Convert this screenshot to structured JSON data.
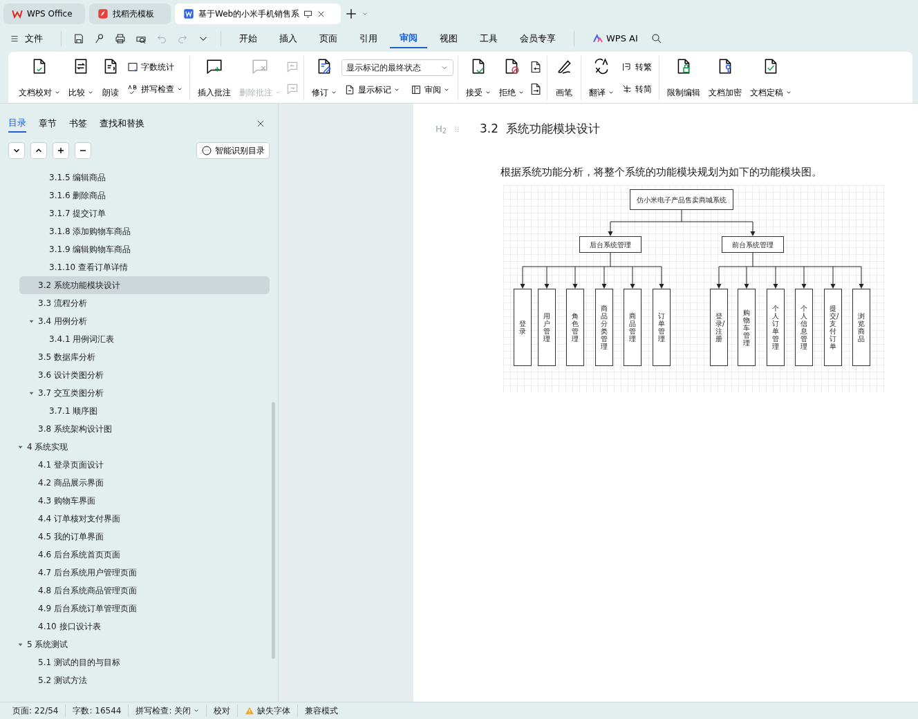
{
  "title_tabs": [
    {
      "label": "WPS Office",
      "selected": false
    },
    {
      "label": "找稻壳模板",
      "selected": false
    },
    {
      "label": "基于Web的小米手机销售系",
      "selected": true
    }
  ],
  "menu": {
    "file": "文件",
    "tabs": [
      {
        "label": "开始",
        "selected": false
      },
      {
        "label": "插入",
        "selected": false
      },
      {
        "label": "页面",
        "selected": false
      },
      {
        "label": "引用",
        "selected": false
      },
      {
        "label": "审阅",
        "selected": true
      },
      {
        "label": "视图",
        "selected": false
      },
      {
        "label": "工具",
        "selected": false
      },
      {
        "label": "会员专享",
        "selected": false
      }
    ],
    "ai": "WPS AI"
  },
  "ribbon": [
    [
      {
        "kind": "big",
        "label": "文档校对",
        "dropdown": true,
        "disabled": false
      },
      {
        "kind": "big",
        "label": "比较",
        "dropdown": true,
        "disabled": false
      },
      {
        "kind": "big",
        "label": "朗读",
        "dropdown": false,
        "disabled": false
      },
      {
        "kind": "stack",
        "items": [
          {
            "label": "字数统计",
            "dropdown": false
          },
          {
            "label": "拼写检查",
            "dropdown": true
          }
        ]
      }
    ],
    [
      {
        "kind": "big",
        "label": "插入批注",
        "dropdown": false,
        "disabled": false
      },
      {
        "kind": "big",
        "label": "删除批注",
        "dropdown": true,
        "disabled": true
      },
      {
        "kind": "icon_pair",
        "disabled": true
      }
    ],
    [
      {
        "kind": "big",
        "label": "修订",
        "dropdown": true,
        "disabled": false
      },
      {
        "kind": "select_stack",
        "value": "显示标记的最终状态",
        "items": [
          {
            "label": "显示标记",
            "dropdown": true
          },
          {
            "label": "审阅",
            "dropdown": true
          }
        ]
      }
    ],
    [
      {
        "kind": "big",
        "label": "接受",
        "dropdown": true,
        "disabled": false
      },
      {
        "kind": "big",
        "label": "拒绝",
        "dropdown": true,
        "disabled": false
      },
      {
        "kind": "icon_pair",
        "disabled": false
      }
    ],
    [
      {
        "kind": "big",
        "label": "画笔",
        "dropdown": false,
        "disabled": false
      }
    ],
    [
      {
        "kind": "big",
        "label": "翻译",
        "dropdown": true,
        "disabled": false
      },
      {
        "kind": "stack",
        "items": [
          {
            "label": "转繁",
            "dropdown": false
          },
          {
            "label": "转简",
            "dropdown": false
          }
        ]
      }
    ],
    [
      {
        "kind": "big",
        "label": "限制编辑",
        "dropdown": false,
        "disabled": false
      },
      {
        "kind": "big",
        "label": "文档加密",
        "dropdown": false,
        "disabled": false
      },
      {
        "kind": "big",
        "label": "文档定稿",
        "dropdown": true,
        "disabled": false
      }
    ]
  ],
  "sidebar": {
    "tabs": [
      {
        "label": "目录",
        "selected": true
      },
      {
        "label": "章节",
        "selected": false
      },
      {
        "label": "书签",
        "selected": false
      },
      {
        "label": "查找和替换",
        "selected": false
      }
    ],
    "smart_button": "智能识别目录",
    "toc": [
      {
        "children": [
          {
            "children": [
              {
                "label": "3.1.5 编辑商品",
                "selected": false
              },
              {
                "label": "3.1.6 删除商品",
                "selected": false
              },
              {
                "label": "3.1.7 提交订单",
                "selected": false
              },
              {
                "label": "3.1.8 添加购物车商品",
                "selected": false
              },
              {
                "label": "3.1.9 编辑购物车商品",
                "selected": false
              },
              {
                "label": "3.1.10 查看订单详情",
                "selected": false
              }
            ]
          },
          {
            "label": "3.2  系统功能模块设计",
            "selected": true
          },
          {
            "label": "3.3  流程分析",
            "selected": false
          },
          {
            "label": "3.4  用例分析",
            "selected": false,
            "expanded": true,
            "children": [
              {
                "label": "3.4.1 用例词汇表",
                "selected": false
              }
            ]
          },
          {
            "label": "3.5  数据库分析",
            "selected": false
          },
          {
            "label": "3.6 设计类图分析",
            "selected": false
          },
          {
            "label": "3.7  交互类图分析",
            "selected": false,
            "expanded": true,
            "children": [
              {
                "label": "3.7.1 顺序图",
                "selected": false
              }
            ]
          },
          {
            "label": "3.8  系统架构设计图",
            "selected": false
          }
        ]
      },
      {
        "label": "4  系统实现",
        "selected": false,
        "expanded": true,
        "children": [
          {
            "label": "4.1 登录页面设计",
            "selected": false
          },
          {
            "label": "4.2 商品展示界面",
            "selected": false
          },
          {
            "label": "4.3  购物车界面",
            "selected": false
          },
          {
            "label": "4.4 订单核对支付界面",
            "selected": false
          },
          {
            "label": "4.5 我的订单界面",
            "selected": false
          },
          {
            "label": "4.6 后台系统首页页面",
            "selected": false
          },
          {
            "label": "4.7 后台系统用户管理页面",
            "selected": false
          },
          {
            "label": "4.8 后台系统商品管理页面",
            "selected": false
          },
          {
            "label": "4.9 后台系统订单管理页面",
            "selected": false
          },
          {
            "label": "4.10 接口设计表",
            "selected": false
          }
        ]
      },
      {
        "label": "5  系统测试",
        "selected": false,
        "expanded": true,
        "children": [
          {
            "label": "5.1  测试的目的与目标",
            "selected": false
          },
          {
            "label": "5.2  测试方法",
            "selected": false
          }
        ]
      }
    ]
  },
  "document": {
    "heading_marker": "H$_{2}$",
    "heading_number": "3.2",
    "heading": "系统功能模块设计",
    "paragraph": "根据系统功能分析，将整个系统的功能模块规划为如下的功能模块图。",
    "diagram": {
      "root": "仿小米电子产品售卖商城系统",
      "branches": [
        {
          "label": "后台系统管理",
          "leaves": [
            "登录",
            "用户管理",
            "角色管理",
            "商品分类管理",
            "商品管理",
            "订单管理"
          ]
        },
        {
          "label": "前台系统管理",
          "leaves": [
            "登录/注册",
            "购物车管理",
            "个人订单管理",
            "个人信息管理",
            "提交/支付订单",
            "浏览商品"
          ]
        }
      ]
    }
  },
  "status_bar": [
    {
      "kind": "text",
      "label": "页面: 22/54"
    },
    {
      "kind": "text",
      "label": "字数: 16544"
    },
    {
      "kind": "dropdown",
      "label": "拼写检查: 关闭"
    },
    {
      "kind": "text",
      "label": "校对"
    },
    {
      "kind": "warning",
      "label": "缺失字体"
    },
    {
      "kind": "text",
      "label": "兼容模式"
    }
  ]
}
